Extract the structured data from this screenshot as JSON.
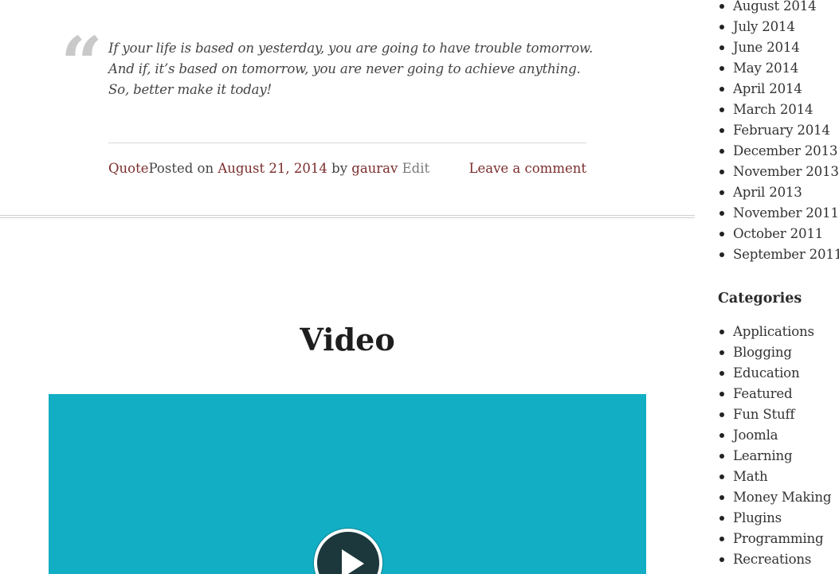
{
  "quote_post": {
    "quote_lines": [
      "If your life is based on yesterday, you are going to have trouble tomorrow.",
      "And if, it’s based on tomorrow, you are never going to achieve anything.",
      "So, better make it today!"
    ],
    "quote_mark": "“",
    "meta": {
      "format_link": "Quote",
      "posted_on_text": "Posted on ",
      "date_link": "August 21, 2014",
      "by_text": " by ",
      "author_link": "gaurav",
      "edit_link": "Edit",
      "comment_link": "Leave a comment"
    }
  },
  "video_post": {
    "title": "Video"
  },
  "sidebar": {
    "archives": [
      "August 2014",
      "July 2014",
      "June 2014",
      "May 2014",
      "April 2014",
      "March 2014",
      "February 2014",
      "December 2013",
      "November 2013",
      "April 2013",
      "November 2011",
      "October 2011",
      "September 2011"
    ],
    "categories_title": "Categories",
    "categories": [
      "Applications",
      "Blogging",
      "Education",
      "Featured",
      "Fun Stuff",
      "Joomla",
      "Learning",
      "Math",
      "Money Making",
      "Plugins",
      "Programming",
      "Recreations"
    ]
  },
  "colors": {
    "link": "#7b2d2d",
    "video_background": "#11aec4",
    "quote_mark": "#c9c9c9"
  }
}
